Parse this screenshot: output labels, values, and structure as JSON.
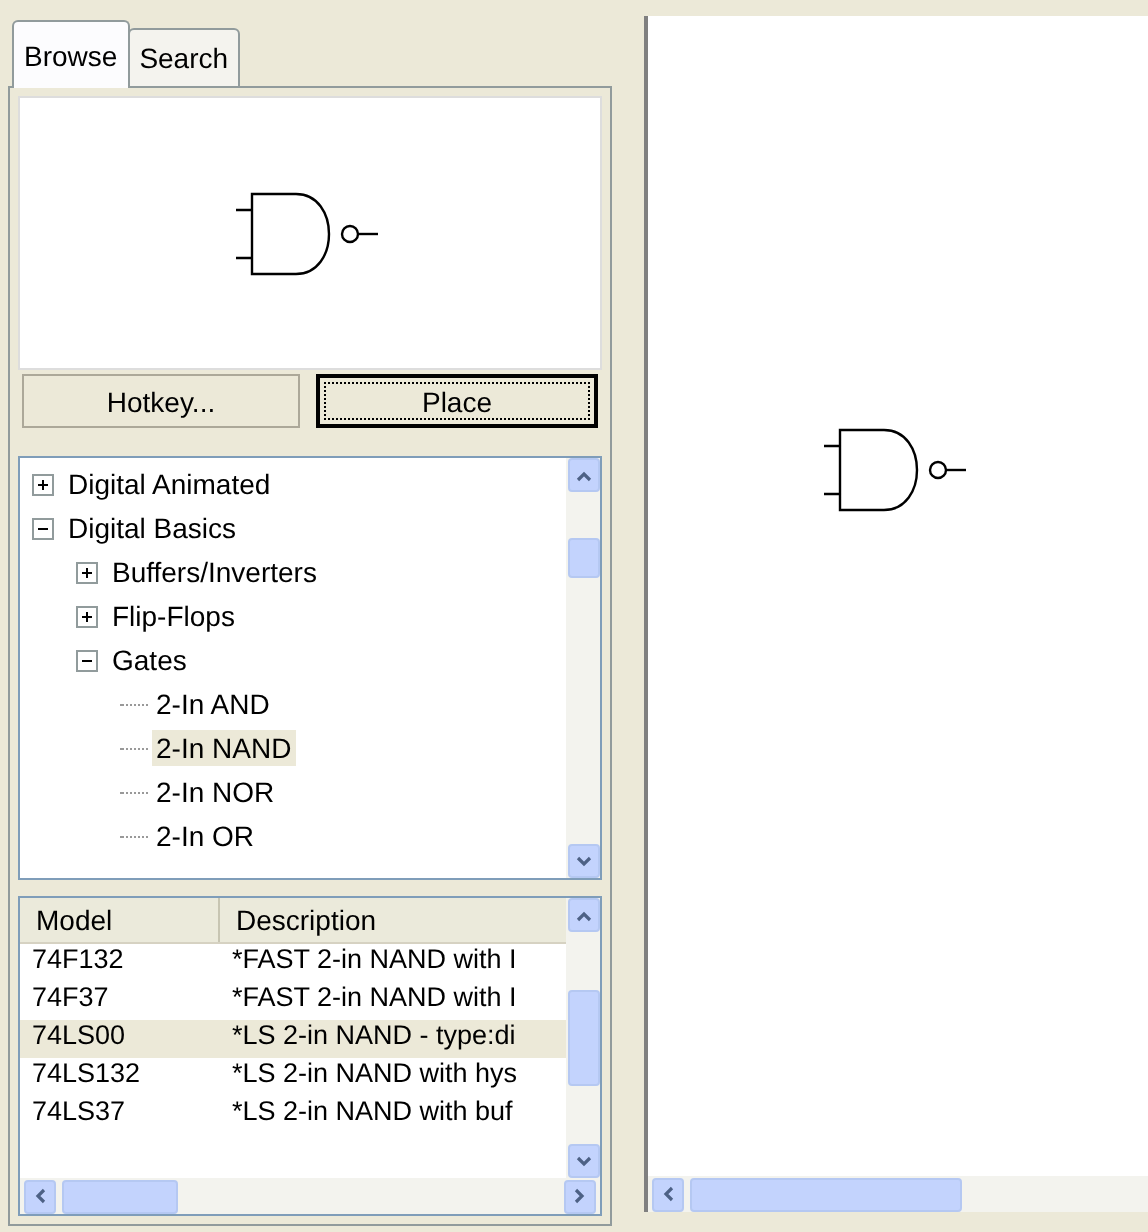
{
  "tabs": [
    {
      "label": "Browse",
      "selected": true
    },
    {
      "label": "Search",
      "selected": false
    }
  ],
  "buttons": [
    {
      "label": "Hotkey...",
      "focused": false
    },
    {
      "label": "Place",
      "focused": true
    }
  ],
  "tree": [
    {
      "kind": "folder",
      "label": "Digital Animated",
      "expanded": false,
      "selected": false
    },
    {
      "kind": "folder",
      "label": "Digital Basics",
      "expanded": true,
      "selected": false,
      "children": [
        {
          "kind": "folder",
          "label": "Buffers/Inverters",
          "expanded": false,
          "selected": false
        },
        {
          "kind": "folder",
          "label": "Flip-Flops",
          "expanded": false,
          "selected": false
        },
        {
          "kind": "folder",
          "label": "Gates",
          "expanded": true,
          "selected": false,
          "children": [
            {
              "kind": "leaf",
              "label": "2-In AND",
              "selected": false
            },
            {
              "kind": "leaf",
              "label": "2-In NAND",
              "selected": true
            },
            {
              "kind": "leaf",
              "label": "2-In NOR",
              "selected": false
            },
            {
              "kind": "leaf",
              "label": "2-In OR",
              "selected": false
            }
          ]
        }
      ]
    }
  ],
  "table": {
    "columns": [
      "Model",
      "Description"
    ],
    "rows": [
      {
        "cells": [
          "74F132",
          "*FAST 2-in NAND with I"
        ],
        "selected": false
      },
      {
        "cells": [
          "74F37",
          "*FAST 2-in NAND with I"
        ],
        "selected": false
      },
      {
        "cells": [
          "74LS00",
          "*LS 2-in NAND - type:di"
        ],
        "selected": true
      },
      {
        "cells": [
          "74LS132",
          "*LS 2-in NAND with hys"
        ],
        "selected": false
      },
      {
        "cells": [
          "74LS37",
          "*LS 2-in NAND with buf"
        ],
        "selected": false
      }
    ]
  }
}
